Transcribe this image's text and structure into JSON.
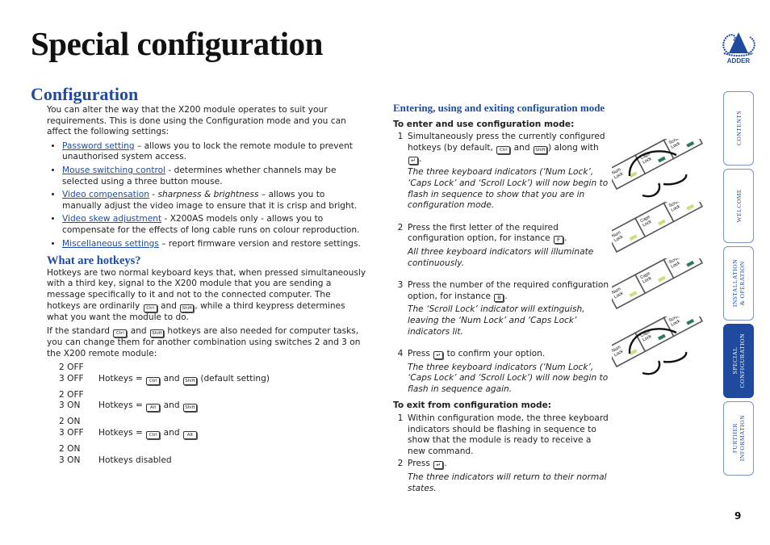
{
  "page": {
    "title": "Special configuration",
    "page_number": "9"
  },
  "logo": {
    "text": "ADDER"
  },
  "colors": {
    "accent": "#1f4a9e",
    "led_on": "#c8e07a",
    "led_off": "#2a7a5a"
  },
  "nav_tabs": [
    {
      "label": "CONTENTS",
      "active": false
    },
    {
      "label": "WELCOME",
      "active": false
    },
    {
      "label": "INSTALLATION\n& OPERATION",
      "active": false
    },
    {
      "label": "SPECIAL\nCONFIGURATION",
      "active": true
    },
    {
      "label": "FURTHER\nINFORMATION",
      "active": false
    }
  ],
  "configuration": {
    "heading": "Configuration",
    "intro": "You can alter the way that the X200 module operates to suit your requirements. This is done using the Configuration mode and you can affect the following settings:",
    "bullets": [
      {
        "link": "Password setting",
        "parts": [
          {
            "t": " – allows you to lock the remote module to prevent unauthorised system access."
          }
        ]
      },
      {
        "link": "Mouse switching control",
        "parts": [
          {
            "t": " - determines whether channels may be selected using a three button mouse."
          }
        ]
      },
      {
        "link": "Video compensation",
        "parts": [
          {
            "t": " - "
          },
          {
            "i": "sharpness & brightness"
          },
          {
            "t": " – allows you to manually adjust the video image to ensure that it is crisp and bright."
          }
        ]
      },
      {
        "link": "Video skew adjustment",
        "parts": [
          {
            "t": " - X200AS models only - allows you to compensate for the effects of long cable runs on colour reproduction."
          }
        ]
      },
      {
        "link": "Miscellaneous settings",
        "parts": [
          {
            "t": " – report firmware version and restore settings."
          }
        ]
      }
    ]
  },
  "hotkeys": {
    "heading": "What are hotkeys?",
    "para1": [
      {
        "t": "Hotkeys are two normal keyboard keys that, when pressed simultaneously with a third key, signal to the X200 module that you are sending a message specifically to it and not to the connected computer. The hotkeys are ordinarily "
      },
      {
        "k": "Ctrl"
      },
      {
        "t": " and "
      },
      {
        "k": "Shift"
      },
      {
        "t": ", while a third keypress determines what you want the module to do."
      }
    ],
    "para2": [
      {
        "t": "If the standard "
      },
      {
        "k": "Ctrl"
      },
      {
        "t": " and "
      },
      {
        "k": "Shift"
      },
      {
        "t": " hotkeys are also needed for computer tasks, you can change them for another combination using switches 2 and 3 on the X200 remote module:"
      }
    ],
    "table": [
      {
        "sw2": "2 OFF",
        "sw3": "3 OFF",
        "desc": [
          {
            "t": "Hotkeys = "
          },
          {
            "k": "Ctrl"
          },
          {
            "t": " and "
          },
          {
            "k": "Shift"
          },
          {
            "t": " (default setting)"
          }
        ]
      },
      {
        "sw2": "2 OFF",
        "sw3": "3 ON",
        "desc": [
          {
            "t": "Hotkeys = "
          },
          {
            "k": "Alt"
          },
          {
            "t": " and "
          },
          {
            "k": "Shift"
          }
        ]
      },
      {
        "sw2": "2 ON",
        "sw3": "3 OFF",
        "desc": [
          {
            "t": "Hotkeys = "
          },
          {
            "k": "Ctrl"
          },
          {
            "t": " and "
          },
          {
            "k": "Alt"
          }
        ]
      },
      {
        "sw2": "2 ON",
        "sw3": "3 ON",
        "desc": [
          {
            "t": "Hotkeys disabled"
          }
        ]
      }
    ]
  },
  "mode": {
    "heading": "Entering, using and exiting configuration mode",
    "enter_title": "To enter and use configuration mode:",
    "enter_steps": [
      {
        "n": "1",
        "text": [
          {
            "t": "Simultaneously press the currently configured hotkeys (by default, "
          },
          {
            "k": "Ctrl"
          },
          {
            "t": " and "
          },
          {
            "k": "Shift"
          },
          {
            "t": ") along with "
          },
          {
            "k": "↵"
          },
          {
            "t": "."
          }
        ],
        "note": "The three keyboard indicators (‘Num Lock’, ‘Caps Lock’ and ‘Scroll Lock’) will now begin to flash in sequence to show that you are in configuration mode.",
        "leds": [
          "on",
          "off",
          "off"
        ],
        "flashing": true
      },
      {
        "n": "2",
        "text": [
          {
            "t": "Press the first letter of the required configuration option, for instance "
          },
          {
            "k": "F"
          },
          {
            "t": "."
          }
        ],
        "note": "All three keyboard indicators will illuminate continuously.",
        "leds": [
          "on",
          "on",
          "on"
        ],
        "flashing": false
      },
      {
        "n": "3",
        "text": [
          {
            "t": "Press the number of the required configuration option, for instance "
          },
          {
            "k": "8"
          },
          {
            "t": "."
          }
        ],
        "note": "The ‘Scroll Lock’ indicator will extinguish, leaving the ‘Num Lock’ and ‘Caps Lock’ indicators lit.",
        "leds": [
          "on",
          "on",
          "off"
        ],
        "flashing": false
      },
      {
        "n": "4",
        "text": [
          {
            "t": "Press "
          },
          {
            "k": "↵"
          },
          {
            "t": " to confirm your option."
          }
        ],
        "note": "The three keyboard indicators (‘Num Lock’, ‘Caps Lock’ and ‘Scroll Lock’) will now begin to flash in sequence again.",
        "leds": [
          "on",
          "off",
          "off"
        ],
        "flashing": true
      }
    ],
    "exit_title": "To exit from configuration mode:",
    "exit_steps": [
      {
        "n": "1",
        "text": [
          {
            "t": "Within configuration mode, the three keyboard indicators should be flashing in sequence to show that the module is ready to receive a new command."
          }
        ],
        "note": ""
      },
      {
        "n": "2",
        "text": [
          {
            "t": "Press "
          },
          {
            "k": "↵"
          },
          {
            "t": "."
          }
        ],
        "note": "The three indicators will return to their normal states."
      }
    ],
    "indicator_labels": [
      [
        "Num",
        "Lock"
      ],
      [
        "Caps",
        "Lock"
      ],
      [
        "Scroll",
        "Lock"
      ]
    ]
  }
}
